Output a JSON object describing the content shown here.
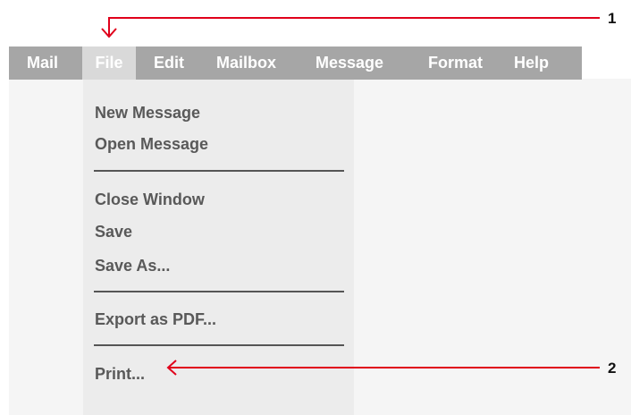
{
  "menubar": {
    "items": [
      {
        "label": "Mail"
      },
      {
        "label": "File",
        "active": true
      },
      {
        "label": "Edit"
      },
      {
        "label": "Mailbox"
      },
      {
        "label": "Message"
      },
      {
        "label": "Format"
      },
      {
        "label": "Help"
      }
    ]
  },
  "file_menu": {
    "groups": [
      [
        "New Message",
        "Open Message"
      ],
      [
        "Close Window",
        "Save",
        "Save As..."
      ],
      [
        "Export as PDF..."
      ],
      [
        "Print..."
      ]
    ]
  },
  "annotations": {
    "callout_1": "1",
    "callout_2": "2",
    "color": "#e0001b"
  },
  "colors": {
    "menubar_bg": "#a6a6a6",
    "menu_active_bg": "#d9d9d9",
    "dropdown_bg": "#ececec",
    "menu_text": "#595959"
  }
}
